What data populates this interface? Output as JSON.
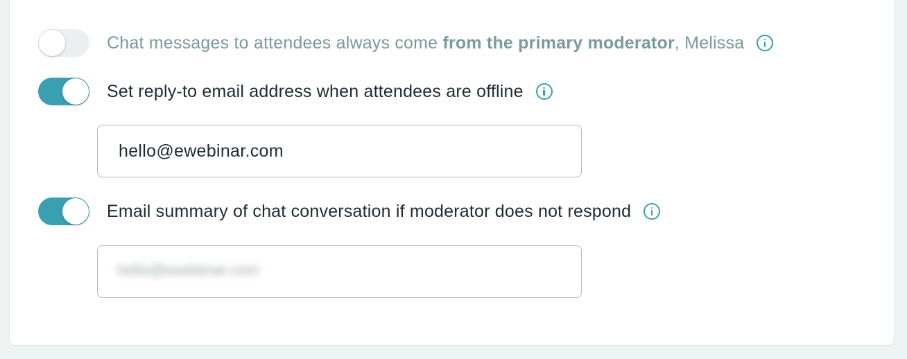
{
  "settings": {
    "primary_moderator": {
      "enabled": false,
      "text_before": "Chat messages to attendees always come ",
      "text_bold": "from the primary moderator",
      "text_after": ", Melissa"
    },
    "reply_to": {
      "enabled": true,
      "label": "Set reply-to email address when attendees are offline",
      "email_value": "hello@ewebinar.com"
    },
    "email_summary": {
      "enabled": true,
      "label": "Email summary of chat conversation if moderator does not respond",
      "email_value_obscured": "hello@ewebinar.com"
    }
  },
  "colors": {
    "accent": "#3a9fb1",
    "toggle_off": "#eceff0",
    "muted_text": "#7a9a9c",
    "text": "#1c2b33",
    "input_border": "#a8bcbd"
  },
  "icons": {
    "info": "info-circle-icon"
  }
}
